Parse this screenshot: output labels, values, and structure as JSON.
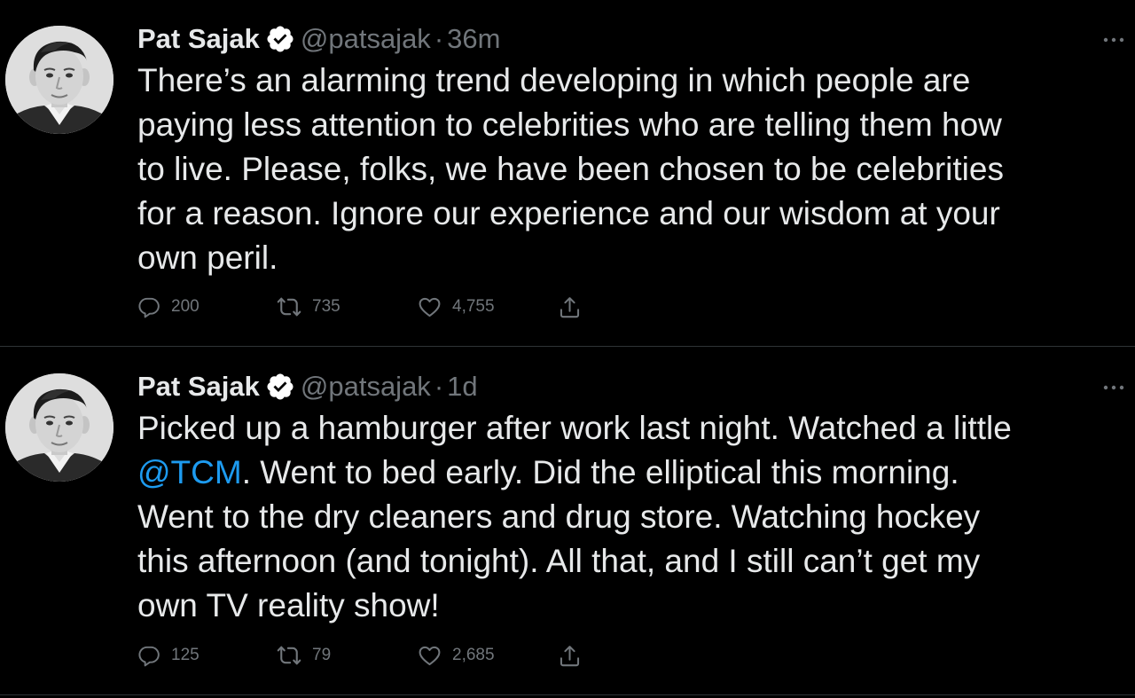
{
  "colors": {
    "background": "#000000",
    "primary_text": "#e7e9ea",
    "secondary_text": "#71767b",
    "link": "#1d9bf0",
    "divider": "#2f3336",
    "verified_badge": "#ffffff"
  },
  "icons": {
    "verified": "verified-badge-icon",
    "more": "more-horizontal-icon",
    "reply": "reply-bubble-icon",
    "retweet": "retweet-icon",
    "like": "heart-icon",
    "share": "share-upload-icon"
  },
  "tweets": [
    {
      "author": {
        "name": "Pat Sajak",
        "handle": "@patsajak"
      },
      "separator": "·",
      "time": "36m",
      "text": "There’s an alarming trend developing in which people are\npaying less attention to celebrities who are telling them how\nto live. Please, folks, we have been chosen to be celebrities\nfor a reason. Ignore our experience and our wisdom at your\nown peril.",
      "stats": {
        "replies": "200",
        "retweets": "735",
        "likes": "4,755"
      }
    },
    {
      "author": {
        "name": "Pat Sajak",
        "handle": "@patsajak"
      },
      "separator": "·",
      "time": "1d",
      "text_before": "Picked up a hamburger after work last night. Watched a little\n",
      "mention": "@TCM",
      "text_after": ". Went to bed early. Did the elliptical this morning.\nWent to the dry cleaners and drug store. Watching hockey\nthis afternoon (and tonight). All that, and I still can’t get my\nown TV reality show!",
      "stats": {
        "replies": "125",
        "retweets": "79",
        "likes": "2,685"
      }
    }
  ]
}
